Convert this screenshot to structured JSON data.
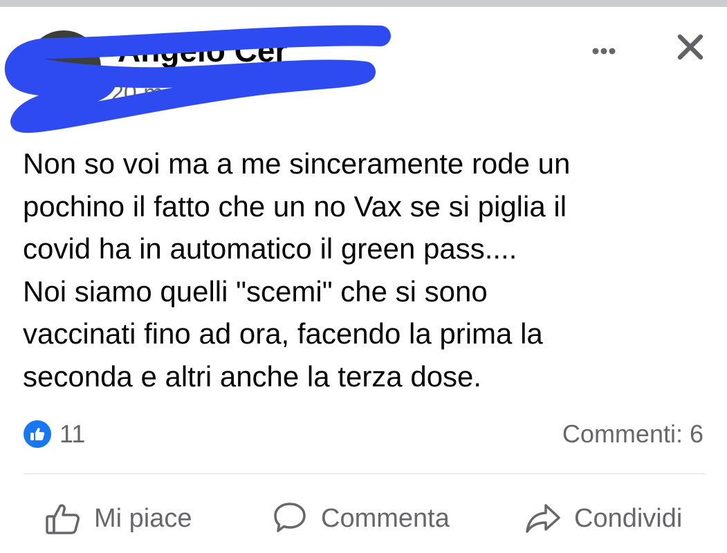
{
  "post": {
    "author_name": "Angelo Cer",
    "time": "20 m",
    "separator": "·",
    "privacy_icon": "globe-icon",
    "more_icon": "more-horizontal-icon",
    "close_icon": "close-icon",
    "text_lines": [
      "Non so voi ma a me sinceramente rode un",
      "pochino il fatto che un no Vax se si piglia il",
      "covid ha in automatico il green pass....",
      "Noi siamo quelli \"scemi\" che si sono",
      "vaccinati fino ad ora, facendo la prima la",
      "seconda e altri anche la terza dose."
    ]
  },
  "stats": {
    "reaction_icon": "like-badge-icon",
    "reaction_count": "11",
    "comments_label": "Commenti: 6"
  },
  "actions": {
    "like_label": "Mi piace",
    "comment_label": "Commenta",
    "share_label": "Condividi"
  },
  "colors": {
    "redaction_scribble": "#2d4bf0",
    "like_blue": "#1877f2",
    "online_green": "#31a24c",
    "secondary_text": "#65676b"
  }
}
